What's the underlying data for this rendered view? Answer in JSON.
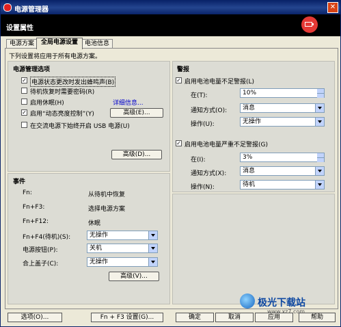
{
  "window": {
    "title": "电源管理器",
    "header_label": "设置属性"
  },
  "tabs": [
    {
      "label": "电源方案"
    },
    {
      "label": "全局电源设置"
    },
    {
      "label": "电池信息"
    }
  ],
  "description": "下列设置将应用于所有电源方案。",
  "power_options": {
    "title": "电源管理选项",
    "items": [
      {
        "label": "电源状态更改时发出蜂鸣声(B)",
        "checked": true
      },
      {
        "label": "待机恢复时需要密码(R)",
        "checked": false
      },
      {
        "label": "启用休眠(H)",
        "checked": false
      },
      {
        "label": "启用“动态亮度控制”(Y)",
        "checked": true
      },
      {
        "label": "在交流电源下始终开启 USB 电源(U)",
        "checked": false
      }
    ],
    "details_link": "详细信息...",
    "advanced1": "高级(E)...",
    "advanced2": "高级(D)..."
  },
  "events": {
    "title": "事件",
    "fn_label": "Fn:",
    "fn_value": "从待机中恢复",
    "fnf3_label": "Fn+F3:",
    "fnf3_value": "选择电源方案",
    "fnf12_label": "Fn+F12:",
    "fnf12_value": "休眠",
    "fnf4_label": "Fn+F4(待机)(S):",
    "fnf4_value": "无操作",
    "power_label": "电源按钮(P):",
    "power_value": "关机",
    "lid_label": "合上盖子(C):",
    "lid_value": "无操作",
    "advanced": "高级(V)..."
  },
  "alarms": {
    "title": "警报",
    "low": {
      "label": "启用电池电量不足警报(L)",
      "checked": true,
      "at_label": "在(T):",
      "at_value": "10%",
      "notify_label": "通知方式(O):",
      "notify_value": "消息",
      "action_label": "操作(U):",
      "action_value": "无操作"
    },
    "critical": {
      "label": "启用电池电量严重不足警报(G)",
      "checked": true,
      "at_label": "在(I):",
      "at_value": "3%",
      "notify_label": "通知方式(X):",
      "notify_value": "消息",
      "action_label": "操作(N):",
      "action_value": "待机"
    }
  },
  "bottom": {
    "options": "选项(O)...",
    "fnf3": "Fn + F3 设置(G)...",
    "ok": "确定",
    "cancel": "取消",
    "apply": "应用",
    "help": "帮助"
  },
  "watermark": {
    "text": "极光下载站",
    "url": "www.xz7.com"
  }
}
